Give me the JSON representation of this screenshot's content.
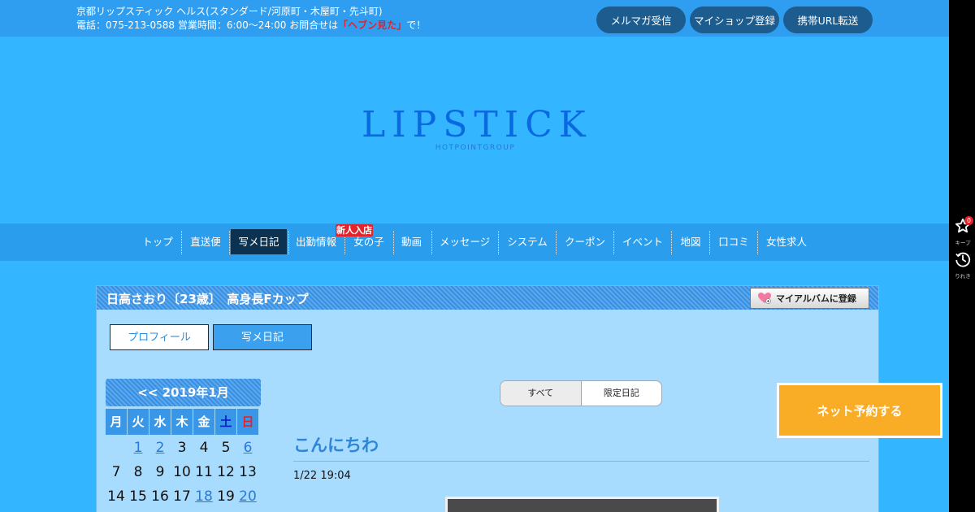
{
  "header": {
    "line1": "京都リップスティック ヘルス(スタンダード/河原町・木屋町・先斗町)",
    "line2_prefix": "電話：075-213-0588 営業時間：6:00～24:00 お問合せは",
    "line2_highlight": "「ヘブン見た」",
    "line2_suffix": "で！",
    "buttons": [
      "メルマガ受信",
      "マイショップ登録",
      "携帯URL転送"
    ]
  },
  "logo": {
    "main": "LIPSTICK",
    "sub": "HOTPOINTGROUP"
  },
  "nav": {
    "items": [
      "トップ",
      "直送便",
      "写メ日記",
      "出勤情報",
      "女の子",
      "動画",
      "メッセージ",
      "システム",
      "クーポン",
      "イベント",
      "地図",
      "口コミ",
      "女性求人"
    ],
    "active_index": 2,
    "badge": "新人入店"
  },
  "profile": {
    "title": "日高さおり〔23歳〕　高身長Fカップ",
    "album_button": "マイアルバムに登録",
    "tabs": [
      "プロフィール",
      "写メ日記"
    ],
    "active_tab": 1
  },
  "calendar": {
    "month_label": "<< 2019年1月",
    "weekdays": [
      "月",
      "火",
      "水",
      "木",
      "金",
      "土",
      "日"
    ],
    "rows": [
      [
        "",
        "1",
        "2",
        "3",
        "4",
        "5",
        "6"
      ],
      [
        "7",
        "8",
        "9",
        "10",
        "11",
        "12",
        "13"
      ],
      [
        "14",
        "15",
        "16",
        "17",
        "18",
        "19",
        "20"
      ]
    ],
    "linked_days": [
      "1",
      "2",
      "6",
      "18",
      "20"
    ]
  },
  "diary": {
    "filters": [
      "すべて",
      "限定日記"
    ],
    "active_filter": 0,
    "post_title": "こんにちわ",
    "post_date": "1/22 19:04"
  },
  "reserve_button": "ネット予約する",
  "side_panel": {
    "keep_label": "キープ",
    "keep_count": "0",
    "history_label": "りれき"
  },
  "colors": {
    "page_bg": "#33b6ff",
    "topbar": "#2f9ef0",
    "nav_active": "#0b3250",
    "reserve": "#f9ac25",
    "highlight_red": "#e8202a"
  }
}
